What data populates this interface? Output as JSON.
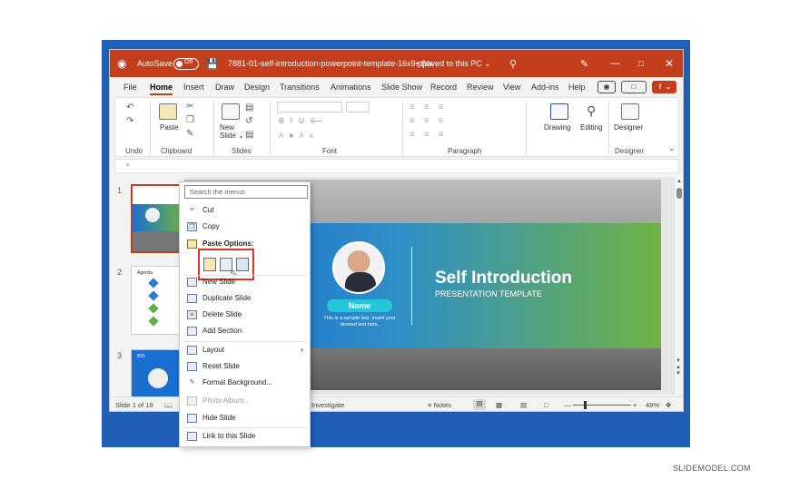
{
  "colors": {
    "accent": "#c43e1c",
    "frame": "#1f5fb8",
    "highlight": "#e0341f",
    "name_pill": "#26c6da"
  },
  "titlebar": {
    "autosave_label": "AutoSave",
    "autosave_state": "Off",
    "filename": "7881-01-self-introduction-powerpoint-template-16x9.pptx",
    "saved_status": "Saved to this PC",
    "icons": [
      "powerpoint-logo-icon",
      "save-icon",
      "search-icon",
      "pen-icon",
      "minimize-icon",
      "maximize-icon",
      "close-icon"
    ]
  },
  "menu": {
    "tabs": [
      "File",
      "Home",
      "Insert",
      "Draw",
      "Design",
      "Transitions",
      "Animations",
      "Slide Show",
      "Record",
      "Review",
      "View",
      "Add-ins",
      "Help"
    ],
    "active_tab": "Home"
  },
  "ribbon": {
    "groups": {
      "undo": "Undo",
      "clipboard": "Clipboard",
      "slides": "Slides",
      "font": "Font",
      "paragraph": "Paragraph",
      "designer": "Designer"
    },
    "buttons": {
      "paste": "Paste",
      "new_slide": "New\nSlide",
      "drawing": "Drawing",
      "editing": "Editing",
      "designer": "Designer"
    }
  },
  "thumbnails": [
    {
      "number": "1",
      "selected": true
    },
    {
      "number": "2",
      "selected": false,
      "heading": "Agenda"
    },
    {
      "number": "3",
      "selected": false,
      "heading": "BIO"
    }
  ],
  "slide": {
    "name": "Name",
    "sample_text": "This is a sample text. Insert your desired text here.",
    "title": "Self Introduction",
    "subtitle": "PRESENTATION TEMPLATE"
  },
  "context_menu": {
    "search_placeholder": "Search the menus",
    "items": {
      "cut": "Cut",
      "copy": "Copy",
      "paste_options": "Paste Options:",
      "new_slide": "New Slide",
      "duplicate_slide": "Duplicate Slide",
      "delete_slide": "Delete Slide",
      "add_section": "Add Section",
      "layout": "Layout",
      "reset_slide": "Reset Slide",
      "format_background": "Format Background...",
      "photo_album": "Photo Album...",
      "hide_slide": "Hide Slide",
      "link_to_this_slide": "Link to this Slide"
    }
  },
  "statusbar": {
    "slide_count": "Slide 1 of 18",
    "accessibility": "Investigate",
    "notes": "Notes",
    "zoom": "49%"
  },
  "watermark": "SLIDEMODEL.COM"
}
